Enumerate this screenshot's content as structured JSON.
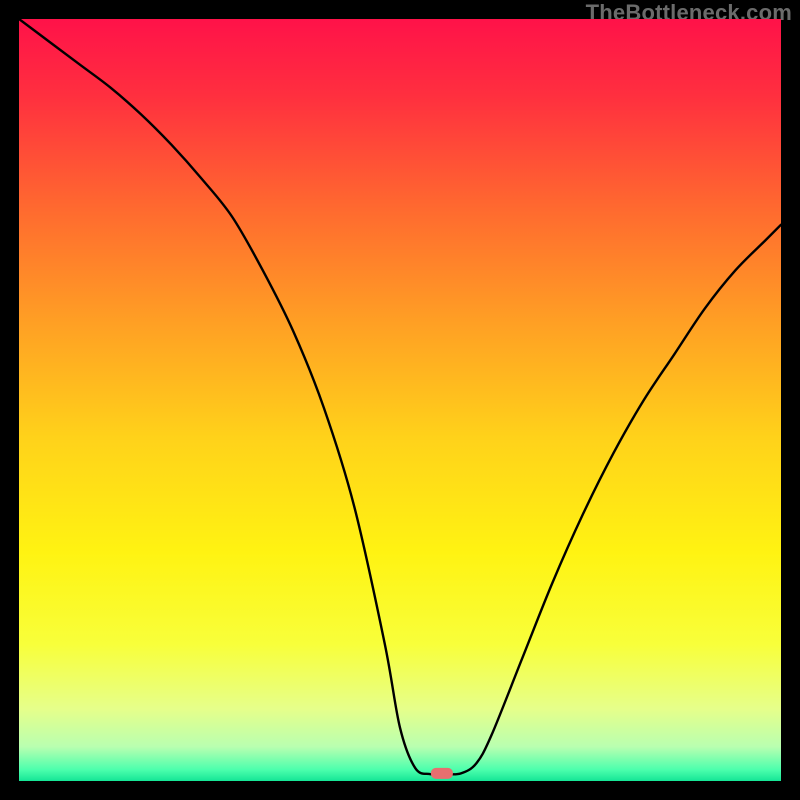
{
  "attribution": "TheBottleneck.com",
  "chart_data": {
    "type": "line",
    "title": "",
    "xlabel": "",
    "ylabel": "",
    "xlim": [
      0,
      100
    ],
    "ylim": [
      0,
      100
    ],
    "series": [
      {
        "name": "curve",
        "x": [
          0,
          4,
          8,
          12,
          16,
          20,
          24,
          28,
          32,
          36,
          40,
          44,
          48,
          50,
          52,
          54,
          56,
          58,
          60,
          62,
          66,
          70,
          74,
          78,
          82,
          86,
          90,
          94,
          98,
          100
        ],
        "y": [
          100,
          97,
          94,
          91,
          87.5,
          83.5,
          79,
          74,
          67,
          59,
          49,
          36,
          18,
          7,
          1.7,
          0.9,
          0.9,
          1.0,
          2.3,
          6,
          16,
          26,
          35,
          43,
          50,
          56,
          62,
          67,
          71,
          73
        ]
      }
    ],
    "marker": {
      "x": 55.5,
      "y": 1.0,
      "color": "#e76f6f"
    },
    "gradient_stops": [
      {
        "offset": 0.0,
        "color": "#ff1249"
      },
      {
        "offset": 0.1,
        "color": "#ff2f3f"
      },
      {
        "offset": 0.25,
        "color": "#ff6a2f"
      },
      {
        "offset": 0.4,
        "color": "#ffa024"
      },
      {
        "offset": 0.55,
        "color": "#ffd21a"
      },
      {
        "offset": 0.7,
        "color": "#fff312"
      },
      {
        "offset": 0.82,
        "color": "#f8ff3a"
      },
      {
        "offset": 0.905,
        "color": "#e6ff8a"
      },
      {
        "offset": 0.955,
        "color": "#b9ffb0"
      },
      {
        "offset": 0.985,
        "color": "#4dffad"
      },
      {
        "offset": 1.0,
        "color": "#15e596"
      }
    ]
  }
}
